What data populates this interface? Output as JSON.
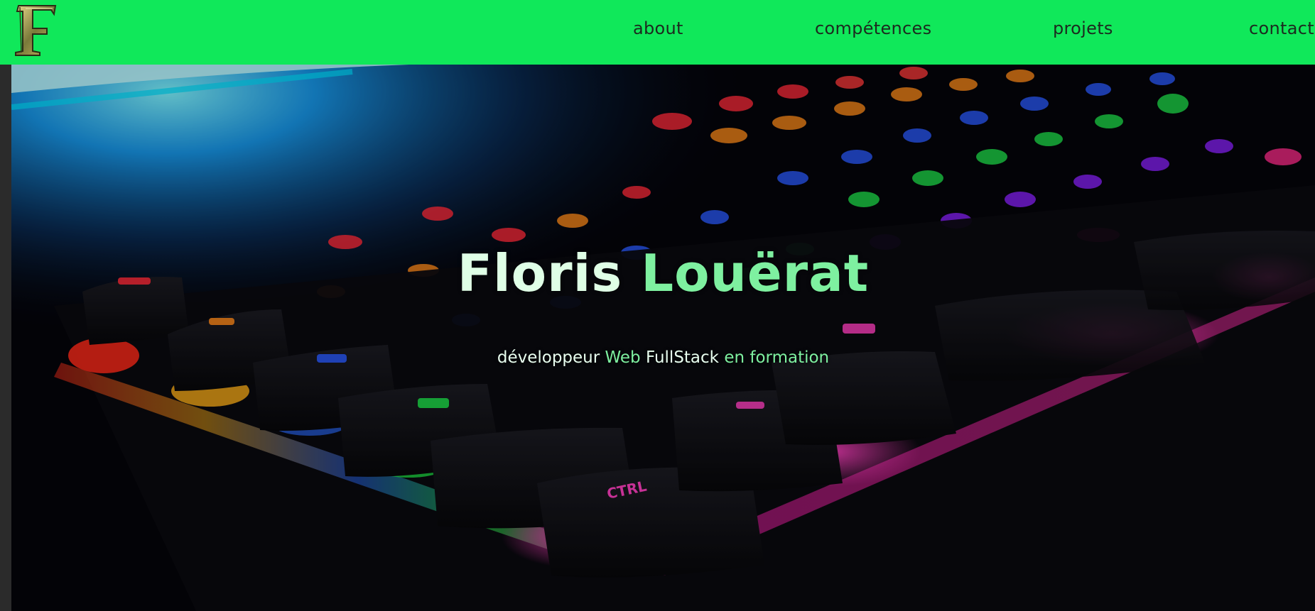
{
  "logo": {
    "letter": "F",
    "icon": "f-monogram-logo"
  },
  "nav": {
    "about": "about",
    "competences": "compétences",
    "projets": "projets",
    "contact": "contact"
  },
  "hero": {
    "title_first": "Floris",
    "title_last": "Louërat",
    "subtitle_word1": "développeur",
    "subtitle_word2": "Web",
    "subtitle_word3": "FullStack",
    "subtitle_word4": "en",
    "subtitle_word5": "formation",
    "background": "rgb-mechanical-keyboard-photo"
  },
  "colors": {
    "header_bg": "#10e85a",
    "accent_green": "#7ef0a0",
    "title_white": "#dfffe6",
    "nav_text": "#1c2a1f"
  }
}
